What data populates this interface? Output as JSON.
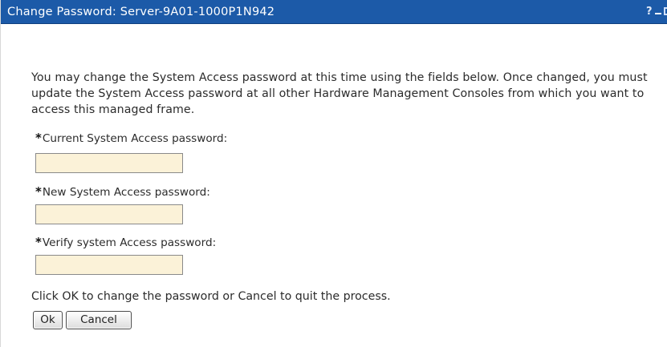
{
  "window": {
    "title": "Change Password: Server-9A01-1000P1N942",
    "help_symbol": "?"
  },
  "intro": {
    "text": "You may change the System Access password at this time using the fields below. Once changed, you must update the System Access password at all other Hardware Management Consoles from which you want to access this managed frame."
  },
  "fields": [
    {
      "required_mark": "*",
      "label": "Current System Access password:",
      "value": ""
    },
    {
      "required_mark": "*",
      "label": "New System Access password:",
      "value": ""
    },
    {
      "required_mark": "*",
      "label": "Verify system Access password:",
      "value": ""
    }
  ],
  "footer": {
    "text": "Click OK to change the password or Cancel to quit the process."
  },
  "buttons": {
    "ok_label": "Ok",
    "cancel_label": "Cancel"
  },
  "colors": {
    "titlebar": "#1c5aa8",
    "input_background": "#fbf2d8"
  }
}
